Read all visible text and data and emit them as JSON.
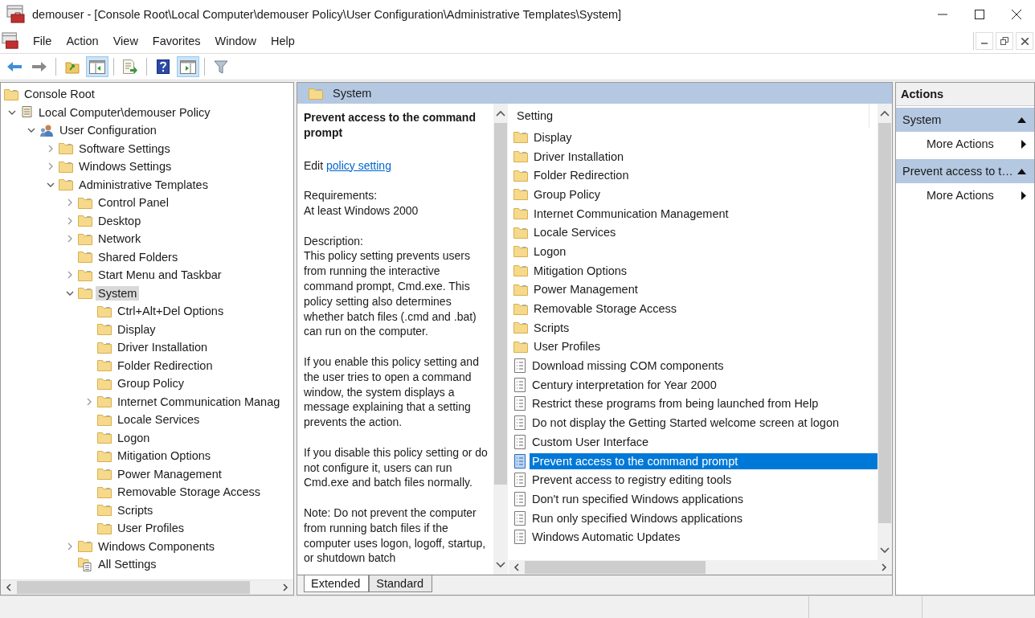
{
  "window": {
    "title": "demouser - [Console Root\\Local Computer\\demouser Policy\\User Configuration\\Administrative Templates\\System]"
  },
  "menu": [
    "File",
    "Action",
    "View",
    "Favorites",
    "Window",
    "Help"
  ],
  "toolbar": [
    {
      "kind": "back",
      "pressed": false
    },
    {
      "kind": "forward",
      "pressed": false
    },
    {
      "kind": "separator"
    },
    {
      "kind": "up",
      "pressed": false
    },
    {
      "kind": "tree-toggle",
      "pressed": true
    },
    {
      "kind": "separator"
    },
    {
      "kind": "export",
      "pressed": false
    },
    {
      "kind": "separator"
    },
    {
      "kind": "help",
      "pressed": false
    },
    {
      "kind": "action-toggle",
      "pressed": true
    },
    {
      "kind": "separator"
    },
    {
      "kind": "filter",
      "pressed": false
    }
  ],
  "tree": [
    {
      "label": "Console Root",
      "kind": "folder",
      "selected": false,
      "children": [
        {
          "label": "Local Computer\\demouser Policy",
          "kind": "policy",
          "expanded": true,
          "selected": false,
          "children": [
            {
              "label": "User Configuration",
              "kind": "user",
              "expanded": true,
              "selected": false,
              "children": [
                {
                  "label": "Software Settings",
                  "kind": "folder",
                  "expanded": false,
                  "selected": false
                },
                {
                  "label": "Windows Settings",
                  "kind": "folder",
                  "expanded": false,
                  "selected": false
                },
                {
                  "label": "Administrative Templates",
                  "kind": "folder",
                  "expanded": true,
                  "selected": false,
                  "children": [
                    {
                      "label": "Control Panel",
                      "kind": "folder",
                      "expanded": false,
                      "selected": false
                    },
                    {
                      "label": "Desktop",
                      "kind": "folder",
                      "expanded": false,
                      "selected": false
                    },
                    {
                      "label": "Network",
                      "kind": "folder",
                      "expanded": false,
                      "selected": false
                    },
                    {
                      "label": "Shared Folders",
                      "kind": "folder",
                      "selected": false
                    },
                    {
                      "label": "Start Menu and Taskbar",
                      "kind": "folder",
                      "expanded": false,
                      "selected": false
                    },
                    {
                      "label": "System",
                      "kind": "folder",
                      "expanded": true,
                      "selected": true,
                      "children": [
                        {
                          "label": "Ctrl+Alt+Del Options",
                          "kind": "folder",
                          "selected": false
                        },
                        {
                          "label": "Display",
                          "kind": "folder",
                          "selected": false
                        },
                        {
                          "label": "Driver Installation",
                          "kind": "folder",
                          "selected": false
                        },
                        {
                          "label": "Folder Redirection",
                          "kind": "folder",
                          "selected": false
                        },
                        {
                          "label": "Group Policy",
                          "kind": "folder",
                          "selected": false
                        },
                        {
                          "label": "Internet Communication Manag",
                          "kind": "folder",
                          "expanded": false,
                          "selected": false
                        },
                        {
                          "label": "Locale Services",
                          "kind": "folder",
                          "selected": false
                        },
                        {
                          "label": "Logon",
                          "kind": "folder",
                          "selected": false
                        },
                        {
                          "label": "Mitigation Options",
                          "kind": "folder",
                          "selected": false
                        },
                        {
                          "label": "Power Management",
                          "kind": "folder",
                          "selected": false
                        },
                        {
                          "label": "Removable Storage Access",
                          "kind": "folder",
                          "selected": false
                        },
                        {
                          "label": "Scripts",
                          "kind": "folder",
                          "selected": false
                        },
                        {
                          "label": "User Profiles",
                          "kind": "folder",
                          "selected": false
                        }
                      ]
                    },
                    {
                      "label": "Windows Components",
                      "kind": "folder",
                      "expanded": false,
                      "selected": false
                    },
                    {
                      "label": "All Settings",
                      "kind": "all-settings",
                      "selected": false
                    }
                  ]
                }
              ]
            }
          ]
        }
      ]
    }
  ],
  "details": {
    "header": "System",
    "title": "Prevent access to the command prompt",
    "edit_prefix": "Edit",
    "edit_link": "policy setting",
    "requirements_label": "Requirements:",
    "requirements": "At least Windows 2000",
    "description_label": "Description:",
    "paragraphs": [
      "This policy setting prevents users from running the interactive command prompt, Cmd.exe.  This policy setting also determines whether batch files (.cmd and .bat) can run on the computer.",
      "If you enable this policy setting and the user tries to open a command window, the system displays a message explaining that a setting prevents the action.",
      "If you disable this policy setting or do not configure it, users can run Cmd.exe and batch files normally.",
      "Note: Do not prevent the computer from running batch files if the computer uses logon, logoff, startup, or shutdown batch"
    ]
  },
  "list": {
    "column": "Setting",
    "items": [
      {
        "label": "Display",
        "kind": "folder",
        "selected": false
      },
      {
        "label": "Driver Installation",
        "kind": "folder",
        "selected": false
      },
      {
        "label": "Folder Redirection",
        "kind": "folder",
        "selected": false
      },
      {
        "label": "Group Policy",
        "kind": "folder",
        "selected": false
      },
      {
        "label": "Internet Communication Management",
        "kind": "folder",
        "selected": false
      },
      {
        "label": "Locale Services",
        "kind": "folder",
        "selected": false
      },
      {
        "label": "Logon",
        "kind": "folder",
        "selected": false
      },
      {
        "label": "Mitigation Options",
        "kind": "folder",
        "selected": false
      },
      {
        "label": "Power Management",
        "kind": "folder",
        "selected": false
      },
      {
        "label": "Removable Storage Access",
        "kind": "folder",
        "selected": false
      },
      {
        "label": "Scripts",
        "kind": "folder",
        "selected": false
      },
      {
        "label": "User Profiles",
        "kind": "folder",
        "selected": false
      },
      {
        "label": "Download missing COM components",
        "kind": "setting",
        "selected": false
      },
      {
        "label": "Century interpretation for Year 2000",
        "kind": "setting",
        "selected": false
      },
      {
        "label": "Restrict these programs from being launched from Help",
        "kind": "setting",
        "selected": false
      },
      {
        "label": "Do not display the Getting Started welcome screen at logon",
        "kind": "setting",
        "selected": false
      },
      {
        "label": "Custom User Interface",
        "kind": "setting",
        "selected": false
      },
      {
        "label": "Prevent access to the command prompt",
        "kind": "setting",
        "selected": true
      },
      {
        "label": "Prevent access to registry editing tools",
        "kind": "setting",
        "selected": false
      },
      {
        "label": "Don't run specified Windows applications",
        "kind": "setting",
        "selected": false
      },
      {
        "label": "Run only specified Windows applications",
        "kind": "setting",
        "selected": false
      },
      {
        "label": "Windows Automatic Updates",
        "kind": "setting",
        "selected": false
      }
    ]
  },
  "view_tabs": [
    {
      "label": "Extended",
      "selected": true
    },
    {
      "label": "Standard",
      "selected": false
    }
  ],
  "actions": {
    "title": "Actions",
    "sections": [
      {
        "title": "System",
        "items": [
          "More Actions"
        ]
      },
      {
        "title": "Prevent access to t…",
        "items": [
          "More Actions"
        ]
      }
    ]
  }
}
